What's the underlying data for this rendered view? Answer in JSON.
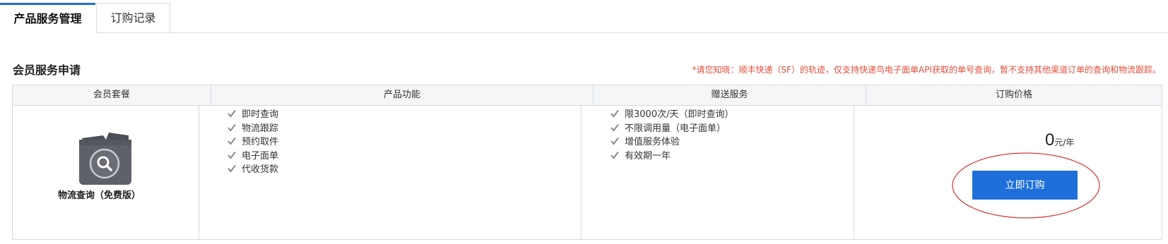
{
  "tabs": [
    {
      "label": "产品服务管理",
      "active": true
    },
    {
      "label": "订购记录",
      "active": false
    }
  ],
  "section": {
    "title": "会员服务申请",
    "notice": "*请您知晓：顺丰快递（SF）的轨迹，仅支持快递鸟电子面单API获取的单号查询，暂不支持其他渠道订单的查询和物流跟踪。"
  },
  "table": {
    "headers": [
      "会员套餐",
      "产品功能",
      "赠送服务",
      "订购价格"
    ],
    "plan": {
      "name": "物流查询（免费版）",
      "icon": "box-search-icon"
    },
    "features": [
      "即时查询",
      "物流跟踪",
      "预约取件",
      "电子面单",
      "代收货款"
    ],
    "gifts": [
      "限3000次/天（即时查询）",
      "不限调用量（电子面单）",
      "增值服务体验",
      "有效期一年"
    ],
    "price": {
      "amount": "0",
      "unit": "元/年"
    },
    "order_button": "立即订购"
  },
  "colors": {
    "accent": "#1e6fd9",
    "notice": "#e24d3c",
    "annotation": "#d23a3a",
    "check": "#8a8a8a",
    "icon_box": "#5f6169"
  }
}
